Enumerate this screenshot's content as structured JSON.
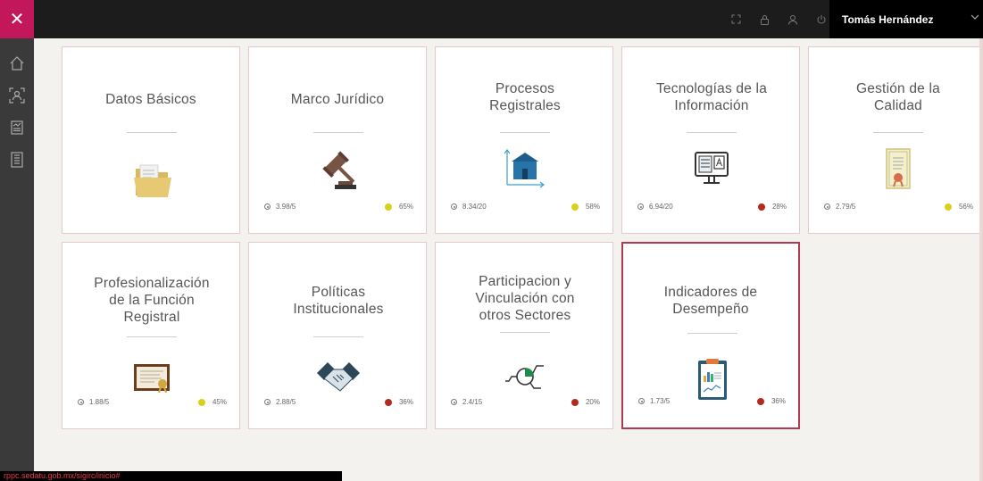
{
  "header": {
    "close_icon": "close-icon",
    "user_name": "Tomás Hernández",
    "icons": [
      "fullscreen-icon",
      "lock-icon",
      "user-icon",
      "power-icon"
    ]
  },
  "sidebar": {
    "items": [
      {
        "icon": "home-icon"
      },
      {
        "icon": "user-scan-icon"
      },
      {
        "icon": "report-icon"
      },
      {
        "icon": "document-icon"
      }
    ]
  },
  "cards": [
    {
      "title": "Datos Básicos",
      "icon": "folder-icon",
      "score": "",
      "pct": "",
      "status": "none"
    },
    {
      "title": "Marco Jurídico",
      "icon": "gavel-icon",
      "score": "3.98/5",
      "pct": "65%",
      "status": "yellow"
    },
    {
      "title": "Procesos Registrales",
      "icon": "building-icon",
      "score": "8.34/20",
      "pct": "58%",
      "status": "yellow"
    },
    {
      "title": "Tecnologías de la Información",
      "icon": "monitor-icon",
      "score": "6.94/20",
      "pct": "28%",
      "status": "red"
    },
    {
      "title": "Gestión de la Calidad",
      "icon": "certificate-icon",
      "score": "2.79/5",
      "pct": "56%",
      "status": "yellow"
    },
    {
      "title": "Profesionalización de la Función Registral",
      "icon": "diploma-icon",
      "score": "1.88/5",
      "pct": "45%",
      "status": "yellow"
    },
    {
      "title": "Políticas Institucionales",
      "icon": "handshake-icon",
      "score": "2.88/5",
      "pct": "36%",
      "status": "red"
    },
    {
      "title": "Participacion y Vinculación con otros Sectores",
      "icon": "network-icon",
      "score": "2.4/15",
      "pct": "20%",
      "status": "red"
    },
    {
      "title": "Indicadores de Desempeño",
      "icon": "clipboard-chart-icon",
      "score": "1.73/5",
      "pct": "36%",
      "status": "red"
    }
  ],
  "colors": {
    "yellow": "#d8d11c",
    "red": "#b52a1f",
    "accent": "#c2185b"
  },
  "status_bar": {
    "url": "rppc.sedatu.gob.mx/sigirc/inicio#"
  }
}
